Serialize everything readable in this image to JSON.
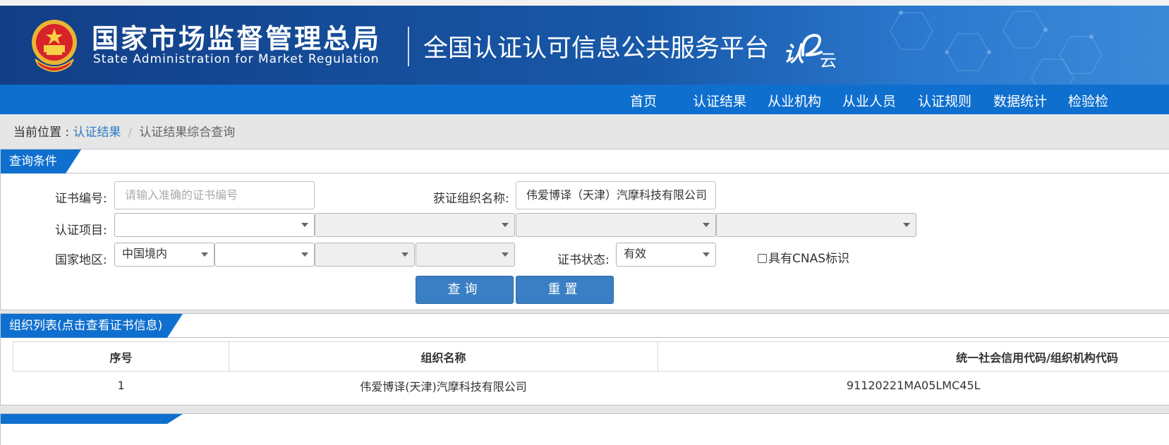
{
  "banner": {
    "agency_cn": "国家市场监督管理总局",
    "agency_en": "State Administration  for  Market Regulation",
    "platform": "全国认证认可信息公共服务平台",
    "logo_text_1": "认",
    "logo_text_2": "云"
  },
  "nav": {
    "items": [
      "首页",
      "认证结果",
      "从业机构",
      "从业人员",
      "认证规则",
      "数据统计",
      "检验检"
    ]
  },
  "breadcrumb": {
    "prefix": "当前位置 : ",
    "link": "认证结果",
    "separator": "/",
    "current": "认证结果综合查询"
  },
  "query": {
    "title": "查询条件",
    "cert_no_label": "证书编号:",
    "cert_no_placeholder": "请输入准确的证书编号",
    "org_name_label": "获证组织名称:",
    "org_name_value": "伟爱博译（天津）汽摩科技有限公司",
    "cert_item_label": "认证项目:",
    "region_label": "国家地区:",
    "region_value": "中国境内",
    "status_label": "证书状态:",
    "status_value": "有效",
    "cnas_label": "具有CNAS标识",
    "search_button": "查询",
    "reset_button": "重置"
  },
  "org_list": {
    "title": "组织列表(点击查看证书信息)",
    "columns": [
      "序号",
      "组织名称",
      "统一社会信用代码/组织机构代码"
    ],
    "rows": [
      [
        "1",
        "伟爱博译(天津)汽摩科技有限公司",
        "91120221MA05LMC45L"
      ]
    ]
  },
  "colors": {
    "banner_dark": "#123e86",
    "nav_blue": "#0f6fcf",
    "button_blue": "#3a7fc3",
    "link_blue": "#2a7bc6"
  }
}
